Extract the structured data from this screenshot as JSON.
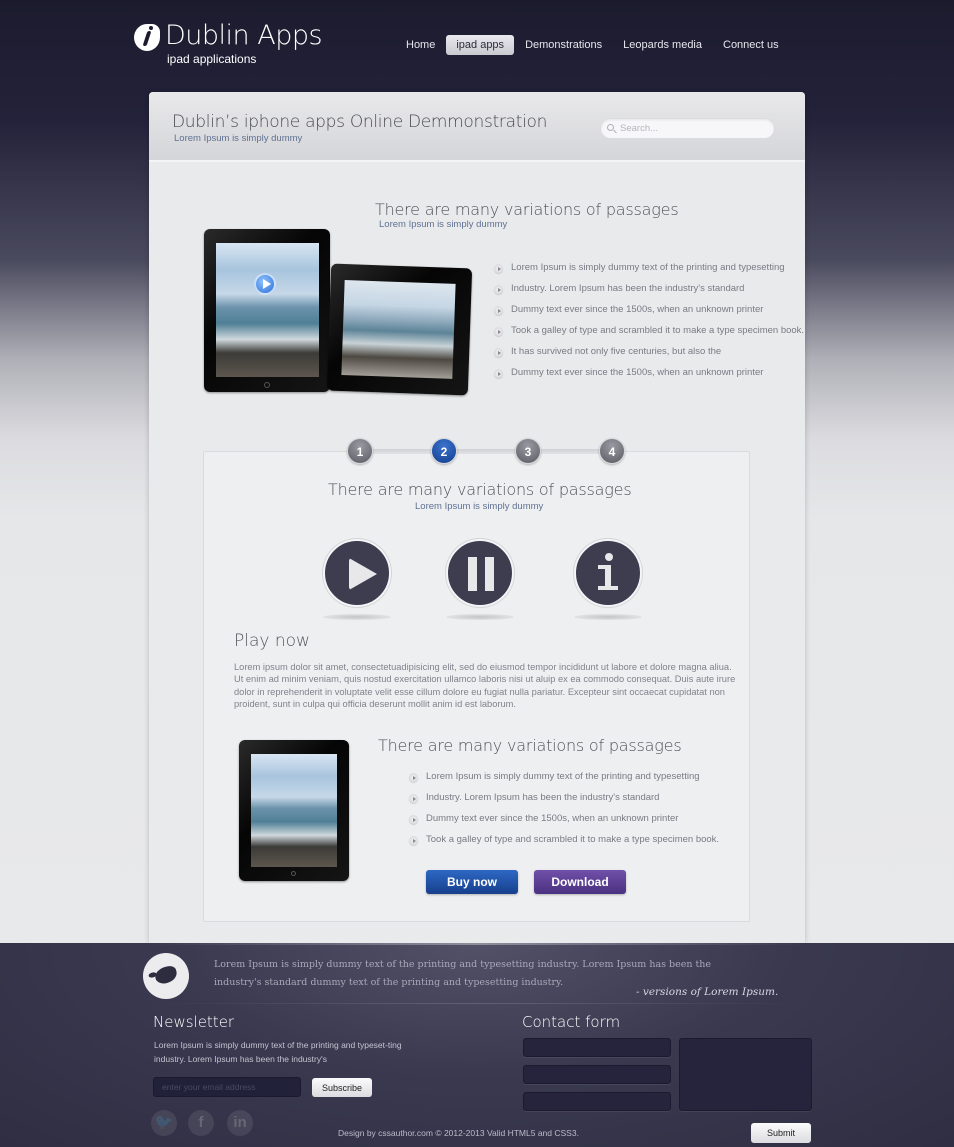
{
  "brand": {
    "logo_icon": "info-leaf-icon",
    "title": "Dublin Apps",
    "subtitle": "ipad applications"
  },
  "nav": {
    "items": [
      {
        "label": "Home",
        "active": false
      },
      {
        "label": "ipad apps",
        "active": true
      },
      {
        "label": "Demonstrations",
        "active": false
      },
      {
        "label": "Leopards media",
        "active": false
      },
      {
        "label": "Connect us",
        "active": false
      }
    ]
  },
  "page_header": {
    "title": "Dublin’s iphone apps Online Demmonstration",
    "subtitle": "Lorem Ipsum is simply dummy",
    "search": {
      "placeholder": "Search...",
      "value": "",
      "icon": "search-icon"
    }
  },
  "section1": {
    "title": "There are many variations of passages",
    "subtitle": "Lorem Ipsum is simply dummy",
    "bullets": [
      "Lorem Ipsum is simply dummy text of the printing and typesetting",
      "Industry. Lorem Ipsum has been the industry's standard",
      "Dummy text ever since the 1500s, when an unknown printer",
      "Took a galley of type and scrambled it to make a type specimen book.",
      "It has survived not only five centuries, but also the",
      "Dummy text ever since the 1500s, when an unknown printer"
    ]
  },
  "steps": {
    "items": [
      "1",
      "2",
      "3",
      "4"
    ],
    "active_index": 1
  },
  "section2": {
    "title": "There are many variations of passages",
    "subtitle": "Lorem Ipsum is simply dummy",
    "media_buttons": [
      {
        "name": "play",
        "icon": "play-icon"
      },
      {
        "name": "pause",
        "icon": "pause-icon"
      },
      {
        "name": "info",
        "icon": "info-icon"
      }
    ],
    "play_title": "Play now",
    "play_text": "Lorem ipsum dolor sit amet, consectetuadipisicing elit, sed do eiusmod tempor incididunt ut labore et dolore magna aliua. Ut enim ad minim veniam, quis nostud exercitation ullamco laboris nisi ut aluip ex ea commodo consequat. Duis aute irure dolor in reprehenderit in voluptate velit esse cillum dolore eu fugiat nulla pariatur. Excepteur sint occaecat cupidatat non proident, sunt in culpa qui officia deserunt mollit anim id est laborum."
  },
  "section3": {
    "title": "There are many variations of passages",
    "bullets": [
      "Lorem Ipsum is simply dummy text of the printing and typesetting",
      "Industry. Lorem Ipsum has been the industry's standard",
      "Dummy text ever since the 1500s, when an unknown printer",
      "Took a galley of type and scrambled it to make a type specimen book."
    ],
    "buy_label": "Buy now",
    "download_label": "Download",
    "colors": {
      "buy": "#1f4fa6",
      "download": "#5d3f94"
    }
  },
  "footer": {
    "tweet": {
      "icon": "twitter-bird-icon",
      "text": "Lorem Ipsum is simply dummy text of the printing and typesetting industry. Lorem Ipsum has been the industry's standard dummy text  of the printing and typesetting industry.",
      "author": "- versions of Lorem Ipsum."
    },
    "newsletter": {
      "title": "Newsletter",
      "text": "Lorem Ipsum is simply dummy text of the printing and typeset-ting industry. Lorem Ipsum has been the industry's",
      "email_placeholder": "enter your email address",
      "email_value": "",
      "subscribe_label": "Subscribe"
    },
    "social": [
      {
        "name": "twitter",
        "glyph": "🐦",
        "icon": "twitter-icon"
      },
      {
        "name": "facebook",
        "glyph": "f",
        "icon": "facebook-icon"
      },
      {
        "name": "linkedin",
        "glyph": "in",
        "icon": "linkedin-icon"
      }
    ],
    "copyright": "Design by cssauthor.com © 2012-2013  Valid HTML5 and CSS3.",
    "contact": {
      "title": "Contact form",
      "fields": [
        "",
        "",
        ""
      ],
      "message": "",
      "submit_label": "Submit"
    }
  }
}
